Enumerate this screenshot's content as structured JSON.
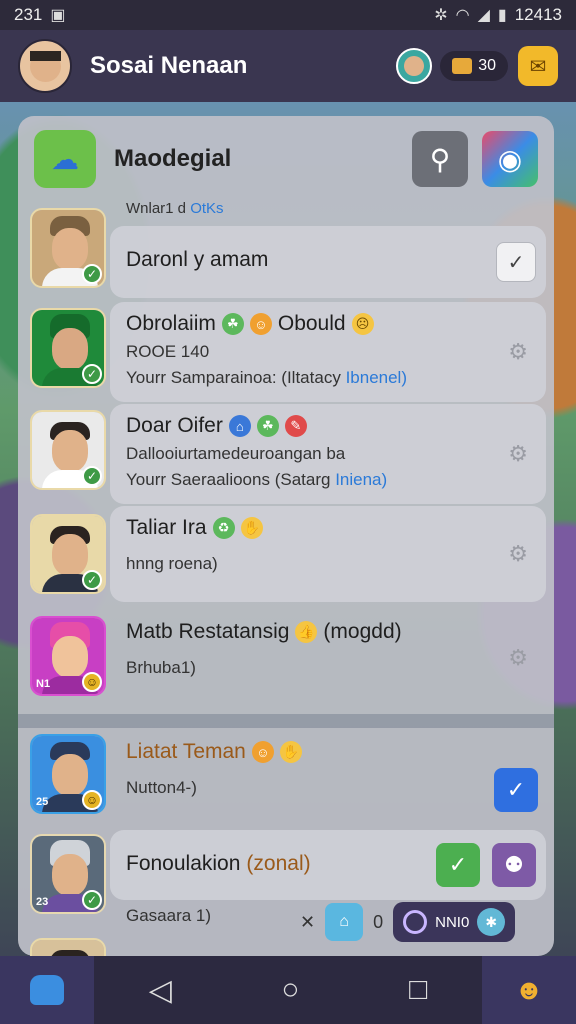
{
  "status_bar": {
    "time": "231",
    "clock_right": "12413"
  },
  "header": {
    "title": "Sosai Nenaan",
    "coins": "30"
  },
  "panel": {
    "title": "Maodegial",
    "small_label_prefix": "Wnlar1 d",
    "small_label_highlight": "OtKs"
  },
  "rows": [
    {
      "name": "Daronl y amam"
    },
    {
      "name": "Obrolaiim",
      "name_suffix": "Obould",
      "line1": "ROOE 140",
      "line2": "Yourr Samparainoa: (Iltatacy",
      "line2_highlight": "Ibnenel)"
    },
    {
      "name": "Doar Oifer",
      "line1": "Dallooiurtamedeuroangan ba",
      "line2": "Yourr Saeraalioons (Satarg",
      "line2_highlight": "Iniena)"
    },
    {
      "name": "Taliar Ira",
      "line1": "hnng roena)"
    },
    {
      "name": "Matb Restatansig",
      "name_suffix": "(mogdd)",
      "line1": "Brhuba1)"
    },
    {
      "name": "Liatat Teman",
      "line1": "Nutton4-)"
    },
    {
      "name": "Fonoulakion",
      "name_suffix": "(zonal)",
      "line1": "Gasaara 1)"
    }
  ],
  "badges": {
    "row5": "N1",
    "row6": "25",
    "row7": "23"
  },
  "footer_strip": {
    "count": "0",
    "pill_label": "NNI0"
  },
  "icons": {
    "home": "home-icon",
    "back": "back-icon",
    "circle": "home-circle-icon",
    "square": "recents-icon"
  }
}
